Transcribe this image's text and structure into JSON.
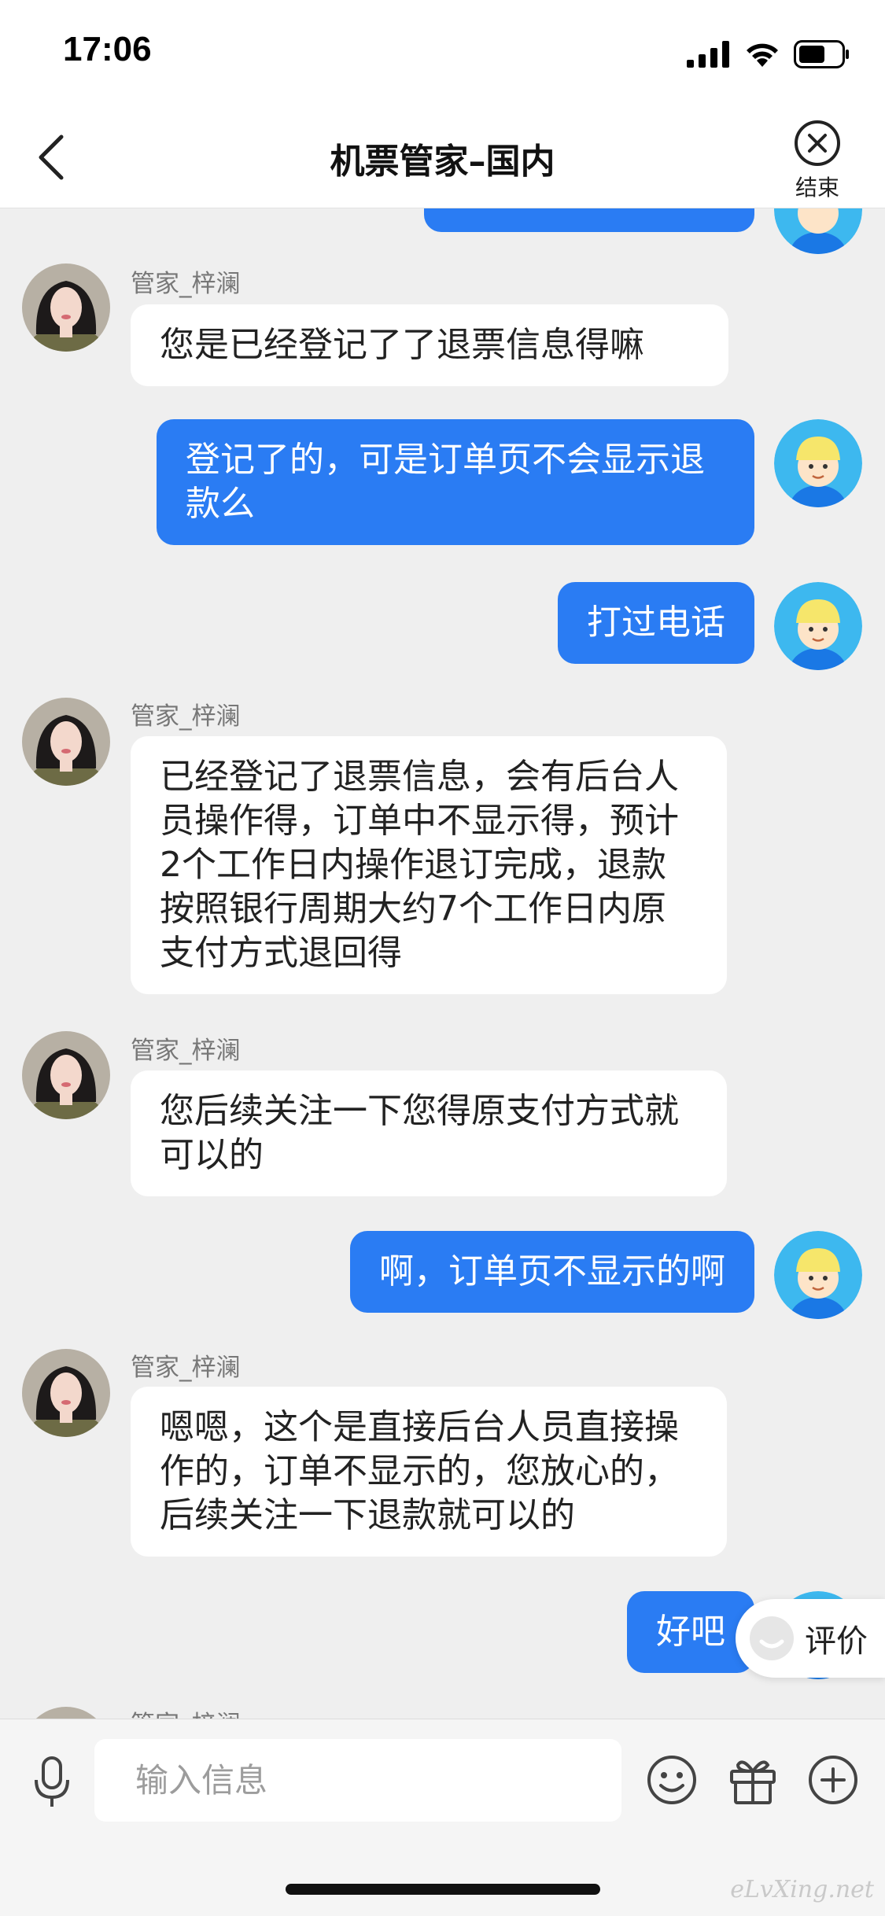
{
  "status_bar": {
    "time": "17:06"
  },
  "header": {
    "title": "机票管家–国内",
    "end_label": "结束"
  },
  "colors": {
    "accent": "#2a7cf3",
    "background": "#efefef",
    "agent_bubble": "#ffffff"
  },
  "messages": [
    {
      "side": "out",
      "text": ""
    },
    {
      "side": "in",
      "sender": "管家_梓澜",
      "text": "您是已经登记了了退票信息得嘛"
    },
    {
      "side": "out",
      "text": "登记了的，可是订单页不会显示退款么"
    },
    {
      "side": "out",
      "text": "打过电话"
    },
    {
      "side": "in",
      "sender": "管家_梓澜",
      "text": "已经登记了退票信息，会有后台人员操作得，订单中不显示得，预计2个工作日内操作退订完成，退款按照银行周期大约7个工作日内原支付方式退回得"
    },
    {
      "side": "in",
      "sender": "管家_梓澜",
      "text": "您后续关注一下您得原支付方式就可以的"
    },
    {
      "side": "out",
      "text": "啊，订单页不显示的啊"
    },
    {
      "side": "in",
      "sender": "管家_梓澜",
      "text": "嗯嗯，这个是直接后台人员直接操作的，订单不显示的，您放心的，后续关注一下退款就可以的"
    },
    {
      "side": "out",
      "text": "好吧"
    },
    {
      "side": "in",
      "sender": "管家_梓澜",
      "text": ""
    }
  ],
  "rate_button": {
    "label": "评价"
  },
  "input": {
    "placeholder": "输入信息"
  },
  "watermark": "eLvXing.net"
}
